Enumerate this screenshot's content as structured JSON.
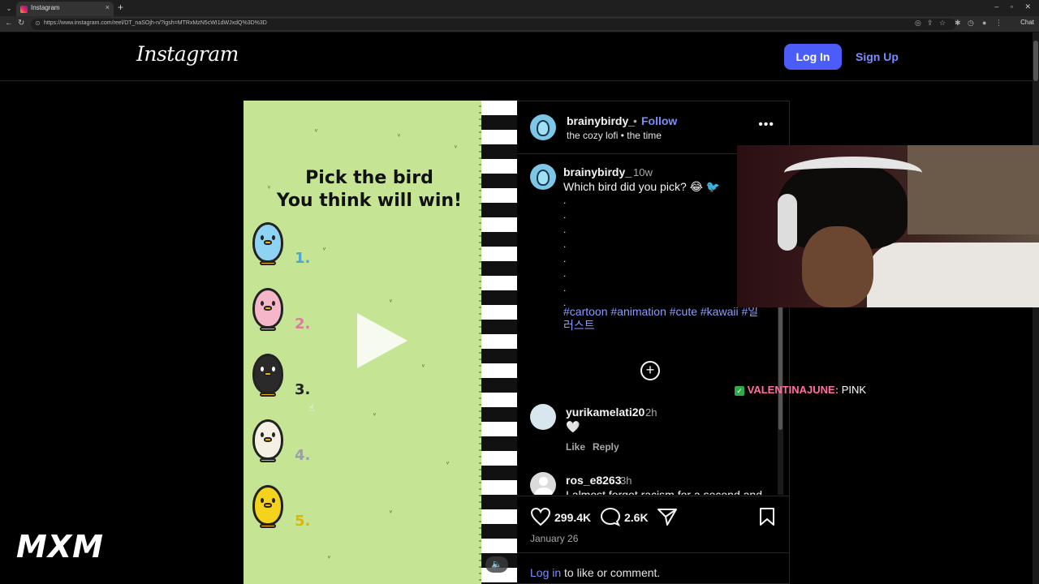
{
  "browser": {
    "tab_title": "Instagram",
    "url": "https://www.instagram.com/reel/DT_naSOjh-n/?igsh=MTRxMzN5cWI1dWJxdQ%3D%3D",
    "chat_button": "Chat",
    "close_glyph": "×",
    "new_tab_glyph": "+"
  },
  "header": {
    "logo": "Instagram",
    "login_label": "Log In",
    "signup_label": "Sign Up"
  },
  "media": {
    "title_line1": "Pick the bird",
    "title_line2": "You think will win!",
    "birds": [
      {
        "number": "1.",
        "color": "#8fd3f4",
        "num_color": "#4aa7d8"
      },
      {
        "number": "2.",
        "color": "#f6b6c9",
        "num_color": "#e07aa0"
      },
      {
        "number": "3.",
        "color": "#2a2a2a",
        "num_color": "#222222"
      },
      {
        "number": "4.",
        "color": "#f4f1e4",
        "num_color": "#9aa0a6"
      },
      {
        "number": "5.",
        "color": "#f5d21b",
        "num_color": "#e0b400"
      }
    ]
  },
  "post": {
    "username": "brainybirdy_",
    "dot": "•",
    "follow_label": "Follow",
    "audio": "the cozy lofi • the time",
    "more_glyph": "•••",
    "caption": {
      "username": "brainybirdy_",
      "time": "10w",
      "text": "Which bird did you pick? 😂 🐦",
      "dots": ". . . . . . . .",
      "hashtags": "#cartoon #animation #cute #kawaii #일러스트"
    },
    "comments": [
      {
        "username": "yurikamelati20",
        "time": "2h",
        "text": "🤍",
        "like": "Like",
        "reply": "Reply"
      },
      {
        "username": "ros_e8263",
        "time": "3h",
        "text": "I almost forgot racism for a second and"
      }
    ],
    "likes": "299.4K",
    "comments_count": "2.6K",
    "date": "January 26",
    "login_link": "Log in",
    "login_suffix": " to like or comment."
  },
  "overlay": {
    "chat_name": "VALENTINAJUNE:",
    "chat_message": "PINK",
    "watermark": "MXM"
  }
}
